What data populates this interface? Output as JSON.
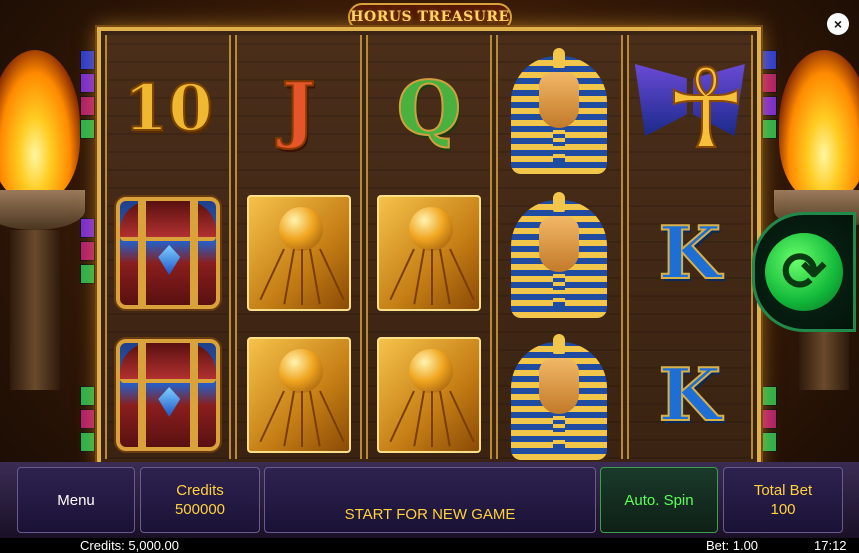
{
  "title": "HORUS TREASURE",
  "close_label": "×",
  "colors": {
    "frame_gold": "#e0b04a",
    "panel_bg": "#2e2250",
    "accent_yellow": "#ffd23a",
    "auto_green": "#5aff5a"
  },
  "reels": [
    [
      "10",
      "chest",
      "chest"
    ],
    [
      "J",
      "scarab-orb",
      "scarab-orb"
    ],
    [
      "Q",
      "scarab-orb",
      "scarab-orb"
    ],
    [
      "pharaoh",
      "pharaoh",
      "pharaoh"
    ],
    [
      "ankh",
      "K",
      "K"
    ]
  ],
  "symbols": {
    "ten": "10",
    "jack": "J",
    "queen": "Q",
    "king": "K",
    "ankh": "☥"
  },
  "payline_colors": {
    "left_top": [
      "#2b3bd0",
      "#7a2ad0",
      "#b01e6a",
      "#2ab04a"
    ],
    "left_mid": [
      "#7a2ad0",
      "#b01e6a",
      "#2ab04a"
    ],
    "left_bot": [
      "#2ab04a",
      "#b01e6a",
      "#2ab04a"
    ],
    "right_top": [
      "#2b3bd0",
      "#b01e6a",
      "#7a2ad0",
      "#2ab04a"
    ],
    "right_bot": [
      "#2ab04a",
      "#b01e6a",
      "#2ab04a"
    ]
  },
  "spin_icon": "refresh-arrows-icon",
  "panel": {
    "menu_label": "Menu",
    "credits_label": "Credits",
    "credits_value": "500000",
    "start_label": "START FOR NEW GAME",
    "auto_spin_label": "Auto. Spin",
    "total_bet_label": "Total Bet",
    "total_bet_value": "100"
  },
  "status": {
    "credits": "Credits: 5,000.00",
    "bet": "Bet: 1.00",
    "time": "17:12"
  }
}
